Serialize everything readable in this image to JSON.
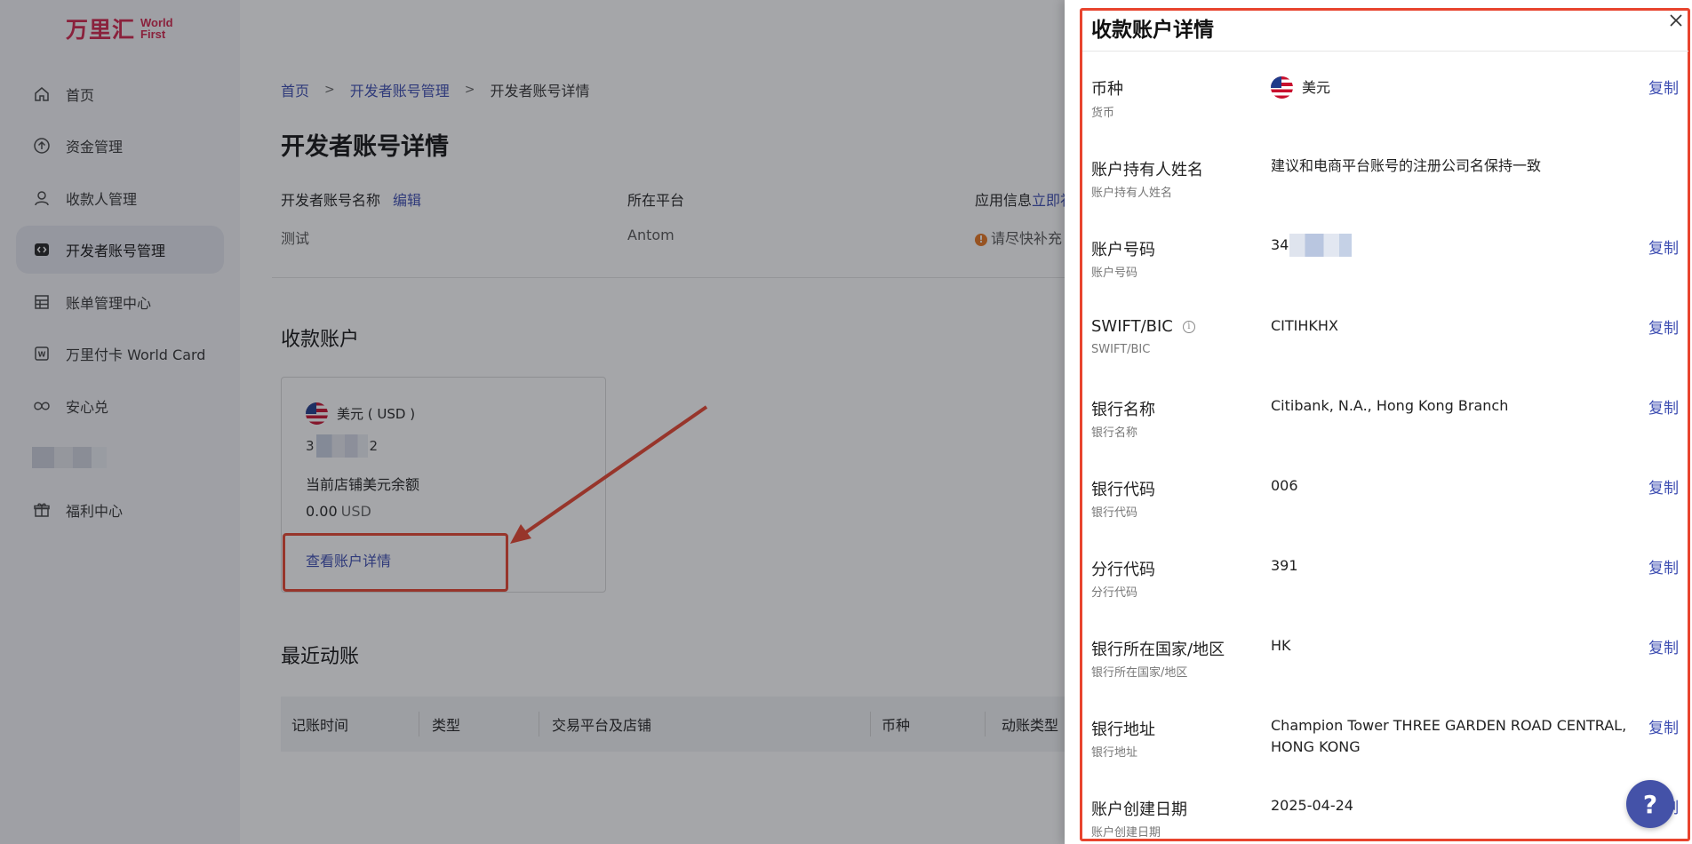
{
  "sidebar": {
    "logo_cn": "万里汇",
    "logo_en_1": "World",
    "logo_en_2": "First",
    "items": [
      {
        "label": "首页"
      },
      {
        "label": "资金管理"
      },
      {
        "label": "收款人管理"
      },
      {
        "label": "开发者账号管理"
      },
      {
        "label": "账单管理中心"
      },
      {
        "label": "万里付卡 World Card"
      },
      {
        "label": "安心兑"
      },
      {
        "label": ""
      },
      {
        "label": "福利中心"
      }
    ]
  },
  "breadcrumb": {
    "home": "首页",
    "level2": "开发者账号管理",
    "current": "开发者账号详情",
    "separator": ">"
  },
  "page": {
    "title": "开发者账号详情",
    "fields": {
      "name_label": "开发者账号名称",
      "edit_link": "编辑",
      "name_value": "测试",
      "platform_label": "所在平台",
      "platform_value": "Antom",
      "appinfo_label": "应用信息",
      "appinfo_link": "立即补",
      "appinfo_warning": "请尽快补充"
    },
    "receiving_section_title": "收款账户",
    "recent_section_title": "最近动账"
  },
  "account_card": {
    "currency": "美元 ( USD )",
    "number_prefix": "3",
    "number_suffix": "2",
    "balance_label": "当前店铺美元余额",
    "balance_amount": "0.00",
    "balance_unit": "USD",
    "detail_link": "查看账户详情"
  },
  "table": {
    "headers": [
      "记账时间",
      "类型",
      "交易平台及店铺",
      "币种",
      "动账类型"
    ]
  },
  "drawer": {
    "title": "收款账户详情",
    "close_symbol": "X",
    "copy_label": "复制",
    "rows": [
      {
        "label": "币种",
        "sub": "货币",
        "value": "美元",
        "copy": true
      },
      {
        "label": "账户持有人姓名",
        "sub": "账户持有人姓名",
        "value": "建议和电商平台账号的注册公司名保持一致",
        "copy": false
      },
      {
        "label": "账户号码",
        "sub": "账户号码",
        "value": "34",
        "copy": true
      },
      {
        "label": "SWIFT/BIC",
        "sub": "SWIFT/BIC",
        "value": "CITIHKHX",
        "copy": true
      },
      {
        "label": "银行名称",
        "sub": "银行名称",
        "value": "Citibank, N.A., Hong Kong Branch",
        "copy": true
      },
      {
        "label": "银行代码",
        "sub": "银行代码",
        "value": "006",
        "copy": true
      },
      {
        "label": "分行代码",
        "sub": "分行代码",
        "value": "391",
        "copy": true
      },
      {
        "label": "银行所在国家/地区",
        "sub": "银行所在国家/地区",
        "value": "HK",
        "copy": true
      },
      {
        "label": "银行地址",
        "sub": "银行地址",
        "value": "Champion Tower THREE GARDEN ROAD CENTRAL, HONG KONG",
        "copy": true
      },
      {
        "label": "账户创建日期",
        "sub": "账户创建日期",
        "value": "2025-04-24",
        "copy": true
      }
    ]
  },
  "help_button": "?",
  "colors": {
    "accent": "#3b4bb1",
    "brand": "#d2224a",
    "annotation": "#e8442e",
    "help": "#4452a8"
  }
}
